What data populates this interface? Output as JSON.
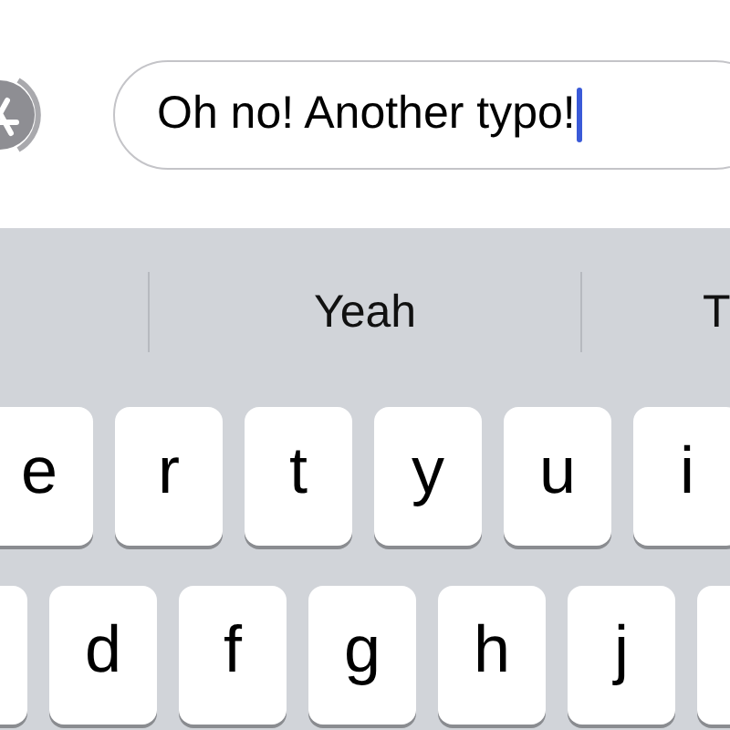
{
  "message_field": {
    "value": "Oh no! Another typo!",
    "focused": true
  },
  "suggestions": [
    {
      "label": "Yeah"
    },
    {
      "label": "T"
    }
  ],
  "key_rows": [
    {
      "keys": [
        {
          "label": "e"
        },
        {
          "label": "r"
        },
        {
          "label": "t"
        },
        {
          "label": "y"
        },
        {
          "label": "u"
        },
        {
          "label": "i"
        }
      ]
    },
    {
      "keys": [
        {
          "label": "d"
        },
        {
          "label": "f"
        },
        {
          "label": "g"
        },
        {
          "label": "h"
        },
        {
          "label": "j"
        }
      ],
      "edge_keys_cut": true
    }
  ]
}
